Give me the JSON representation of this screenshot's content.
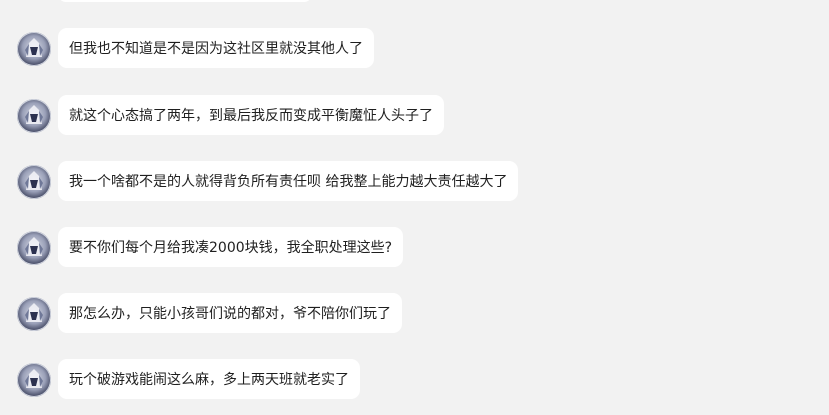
{
  "messages": [
    {
      "text": "但我也不知道是不是因为这社区里就没其他人了",
      "avatar_icon": "character-avatar-icon"
    },
    {
      "text": "就这个心态搞了两年，到最后我反而变成平衡魔怔人头子了",
      "avatar_icon": "character-avatar-icon"
    },
    {
      "text": "我一个啥都不是的人就得背负所有责任呗 给我整上能力越大责任越大了",
      "avatar_icon": "character-avatar-icon"
    },
    {
      "text": "要不你们每个月给我凑2000块钱，我全职处理这些?",
      "avatar_icon": "character-avatar-icon"
    },
    {
      "text": "那怎么办，只能小孩哥们说的都对，爷不陪你们玩了",
      "avatar_icon": "character-avatar-icon"
    },
    {
      "text": "玩个破游戏能闹这么麻，多上两天班就老实了",
      "avatar_icon": "character-avatar-icon"
    }
  ],
  "colors": {
    "background": "#f2f2f2",
    "bubble": "#ffffff",
    "text": "#1f1f1f"
  }
}
